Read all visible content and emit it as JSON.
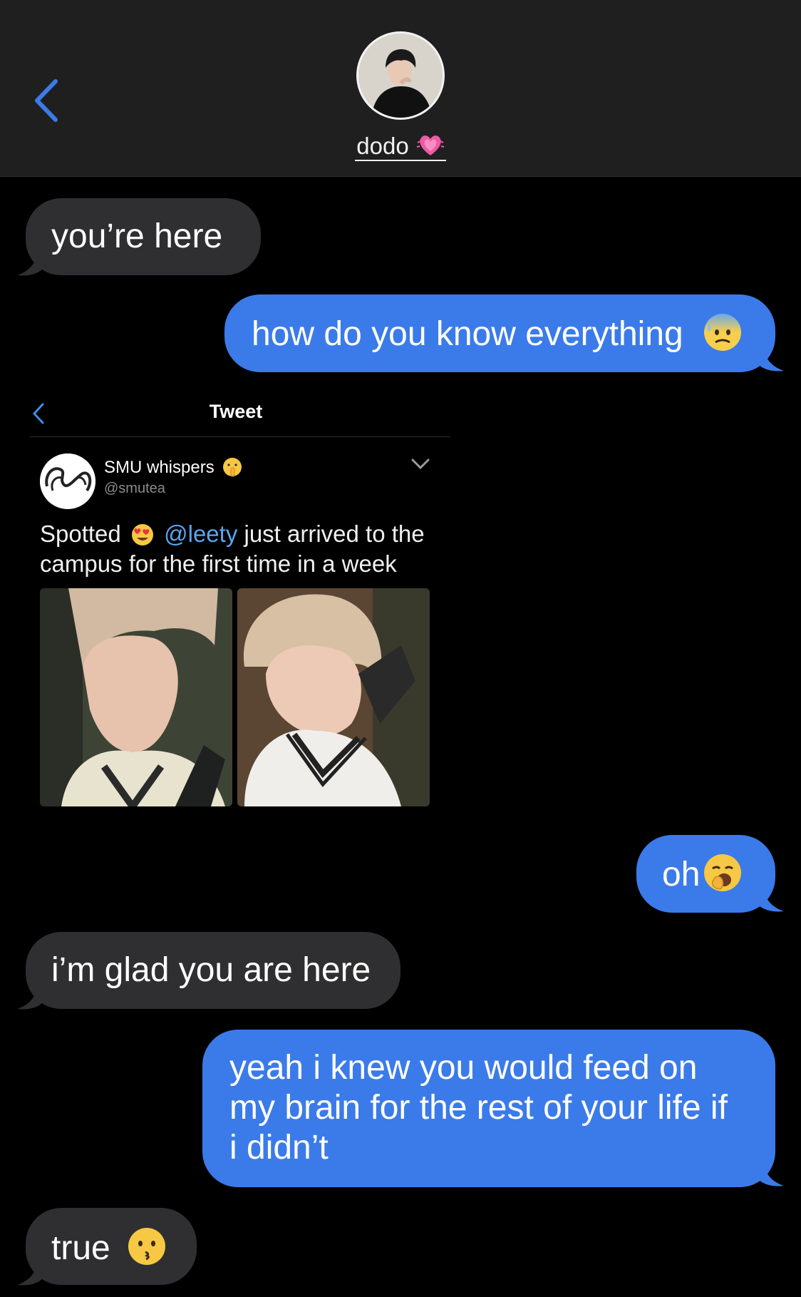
{
  "header": {
    "contact_name": "dodo",
    "back_icon": "chevron-left-icon",
    "avatar_icon": "contact-avatar",
    "name_emoji": "growing-heart-emoji"
  },
  "messages": [
    {
      "direction": "incoming",
      "text": "you’re here"
    },
    {
      "direction": "outgoing",
      "text": "how do you know everything",
      "emoji": "anxious-face-with-sweat-emoji"
    },
    {
      "direction": "outgoing-attachment",
      "type": "tweet-screenshot"
    },
    {
      "direction": "outgoing",
      "text": "oh",
      "emoji": "yawning-face-emoji"
    },
    {
      "direction": "incoming",
      "text": "i’m glad you are here"
    },
    {
      "direction": "outgoing",
      "lines": [
        "yeah i knew you would feed on",
        "my brain for the rest of your life if",
        "i didn’t"
      ]
    },
    {
      "direction": "incoming",
      "text": "true",
      "emoji": "kissing-face-emoji"
    }
  ],
  "tweet": {
    "title": "Tweet",
    "user_name": "SMU whispers",
    "user_emoji": "shushing-face-emoji",
    "handle": "@smutea",
    "text_prefix": "Spotted",
    "text_emoji": "heart-eyes-emoji",
    "mention": "@leety",
    "text_suffix": "just arrived to the",
    "text_line2": "campus for the first time in a week",
    "photos": [
      "photo-left",
      "photo-right"
    ]
  },
  "colors": {
    "background": "#000000",
    "header_bg": "#1f1f1f",
    "incoming_bubble": "#2f2f31",
    "outgoing_bubble": "#3b7be9",
    "accent_blue": "#3b7be9",
    "mention_blue": "#5ba4f0"
  }
}
